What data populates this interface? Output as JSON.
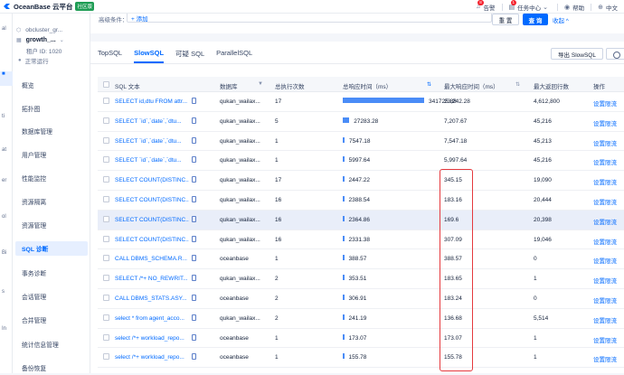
{
  "app": {
    "title": "OceanBase 云平台",
    "edition": "社区版"
  },
  "topbar": {
    "alerts": "告警",
    "alerts_count": "8",
    "tasks": "任务中心",
    "tasks_count": "1",
    "help": "帮助",
    "lang": "中文"
  },
  "rail": {
    "items": [
      "al",
      "ti",
      "at",
      "er",
      "ol",
      "Bi",
      "s",
      "In"
    ]
  },
  "cluster": {
    "cluster_name": "obcluster_gr...",
    "tenant_name": "growth_...",
    "tenant_id": "租户 ID: 1020",
    "status": "正常运行"
  },
  "nav": {
    "items": [
      "概览",
      "拓扑图",
      "数据库管理",
      "用户管理",
      "性能监控",
      "资源隔离",
      "资源管理",
      "SQL 诊断",
      "事务诊断",
      "会话管理",
      "合并管理",
      "统计信息管理",
      "备份恢复"
    ],
    "active": "SQL 诊断"
  },
  "filter": {
    "label": "高级条件：",
    "add": "+ 添加",
    "reset": "重 置",
    "query": "查 询",
    "collapse": "收起 ^"
  },
  "tabs": [
    "TopSQL",
    "SlowSQL",
    "可疑 SQL",
    "ParallelSQL"
  ],
  "active_tab": "SlowSQL",
  "export": "导出 SlowSQL",
  "table": {
    "headers": {
      "sql": "SQL 文本",
      "db": "数据库",
      "count": "总执行次数",
      "total": "总响应时间（ms）",
      "max_resp": "最大响应时间（ms）",
      "max_ret": "最大返回行数",
      "op": "操作"
    },
    "rows": [
      {
        "sql": "SELECT id,dtu FROM attr...",
        "db": "qukan_wailax...",
        "count": "17",
        "total": "341725.88",
        "bar": 1.0,
        "max_resp": "23,242.28",
        "max_ret": "4,612,800",
        "op": "设置限流"
      },
      {
        "sql": "SELECT `id`,`date`,`dtu...",
        "db": "qukan_wailax...",
        "count": "5",
        "total": "27283.28",
        "bar": 0.08,
        "max_resp": "7,207.67",
        "max_ret": "45,216",
        "op": "设置限流"
      },
      {
        "sql": "SELECT `id`,`date`,`dtu...",
        "db": "qukan_wailax...",
        "count": "1",
        "total": "7547.18",
        "bar": 0.022,
        "max_resp": "7,547.18",
        "max_ret": "45,213",
        "op": "设置限流"
      },
      {
        "sql": "SELECT `id`,`date`,`dtu...",
        "db": "qukan_wailax...",
        "count": "1",
        "total": "5997.64",
        "bar": 0.018,
        "max_resp": "5,997.64",
        "max_ret": "45,216",
        "op": "设置限流"
      },
      {
        "sql": "SELECT COUNT(DISTINC...",
        "db": "qukan_wailax...",
        "count": "17",
        "total": "2447.22",
        "bar": 0.007,
        "max_resp": "345.15",
        "max_ret": "19,090",
        "op": "设置限流"
      },
      {
        "sql": "SELECT COUNT(DISTINC...",
        "db": "qukan_wailax...",
        "count": "16",
        "total": "2388.54",
        "bar": 0.007,
        "max_resp": "183.16",
        "max_ret": "20,444",
        "op": "设置限流"
      },
      {
        "sql": "SELECT COUNT(DISTINC...",
        "db": "qukan_wailax...",
        "count": "16",
        "total": "2364.86",
        "bar": 0.007,
        "max_resp": "169.6",
        "max_ret": "20,398",
        "op": "设置限流"
      },
      {
        "sql": "SELECT COUNT(DISTINC...",
        "db": "qukan_wailax...",
        "count": "16",
        "total": "2331.38",
        "bar": 0.007,
        "max_resp": "307.09",
        "max_ret": "19,046",
        "op": "设置限流"
      },
      {
        "sql": "CALL DBMS_SCHEMA.R...",
        "db": "oceanbase",
        "count": "1",
        "total": "388.57",
        "bar": 0.001,
        "max_resp": "388.57",
        "max_ret": "0",
        "op": "设置限流"
      },
      {
        "sql": "SELECT /*+ NO_REWRIT...",
        "db": "qukan_wailax...",
        "count": "2",
        "total": "353.51",
        "bar": 0.001,
        "max_resp": "183.65",
        "max_ret": "1",
        "op": "设置限流"
      },
      {
        "sql": "CALL DBMS_STATS.ASY...",
        "db": "oceanbase",
        "count": "2",
        "total": "306.91",
        "bar": 0.001,
        "max_resp": "183.24",
        "max_ret": "0",
        "op": "设置限流"
      },
      {
        "sql": "select * from agent_acco...",
        "db": "qukan_wailax...",
        "count": "2",
        "total": "241.19",
        "bar": 0.001,
        "max_resp": "136.68",
        "max_ret": "5,514",
        "op": "设置限流"
      },
      {
        "sql": "select /*+ workload_repo...",
        "db": "oceanbase",
        "count": "1",
        "total": "173.07",
        "bar": 0.0005,
        "max_resp": "173.07",
        "max_ret": "1",
        "op": "设置限流"
      },
      {
        "sql": "select /*+ workload_repo...",
        "db": "oceanbase",
        "count": "1",
        "total": "155.78",
        "bar": 0.0005,
        "max_resp": "155.78",
        "max_ret": "1",
        "op": "设置限流"
      }
    ]
  },
  "colors": {
    "accent": "#006aff",
    "highlight_box": "#e5393e",
    "bar": "#4a8cf7"
  }
}
